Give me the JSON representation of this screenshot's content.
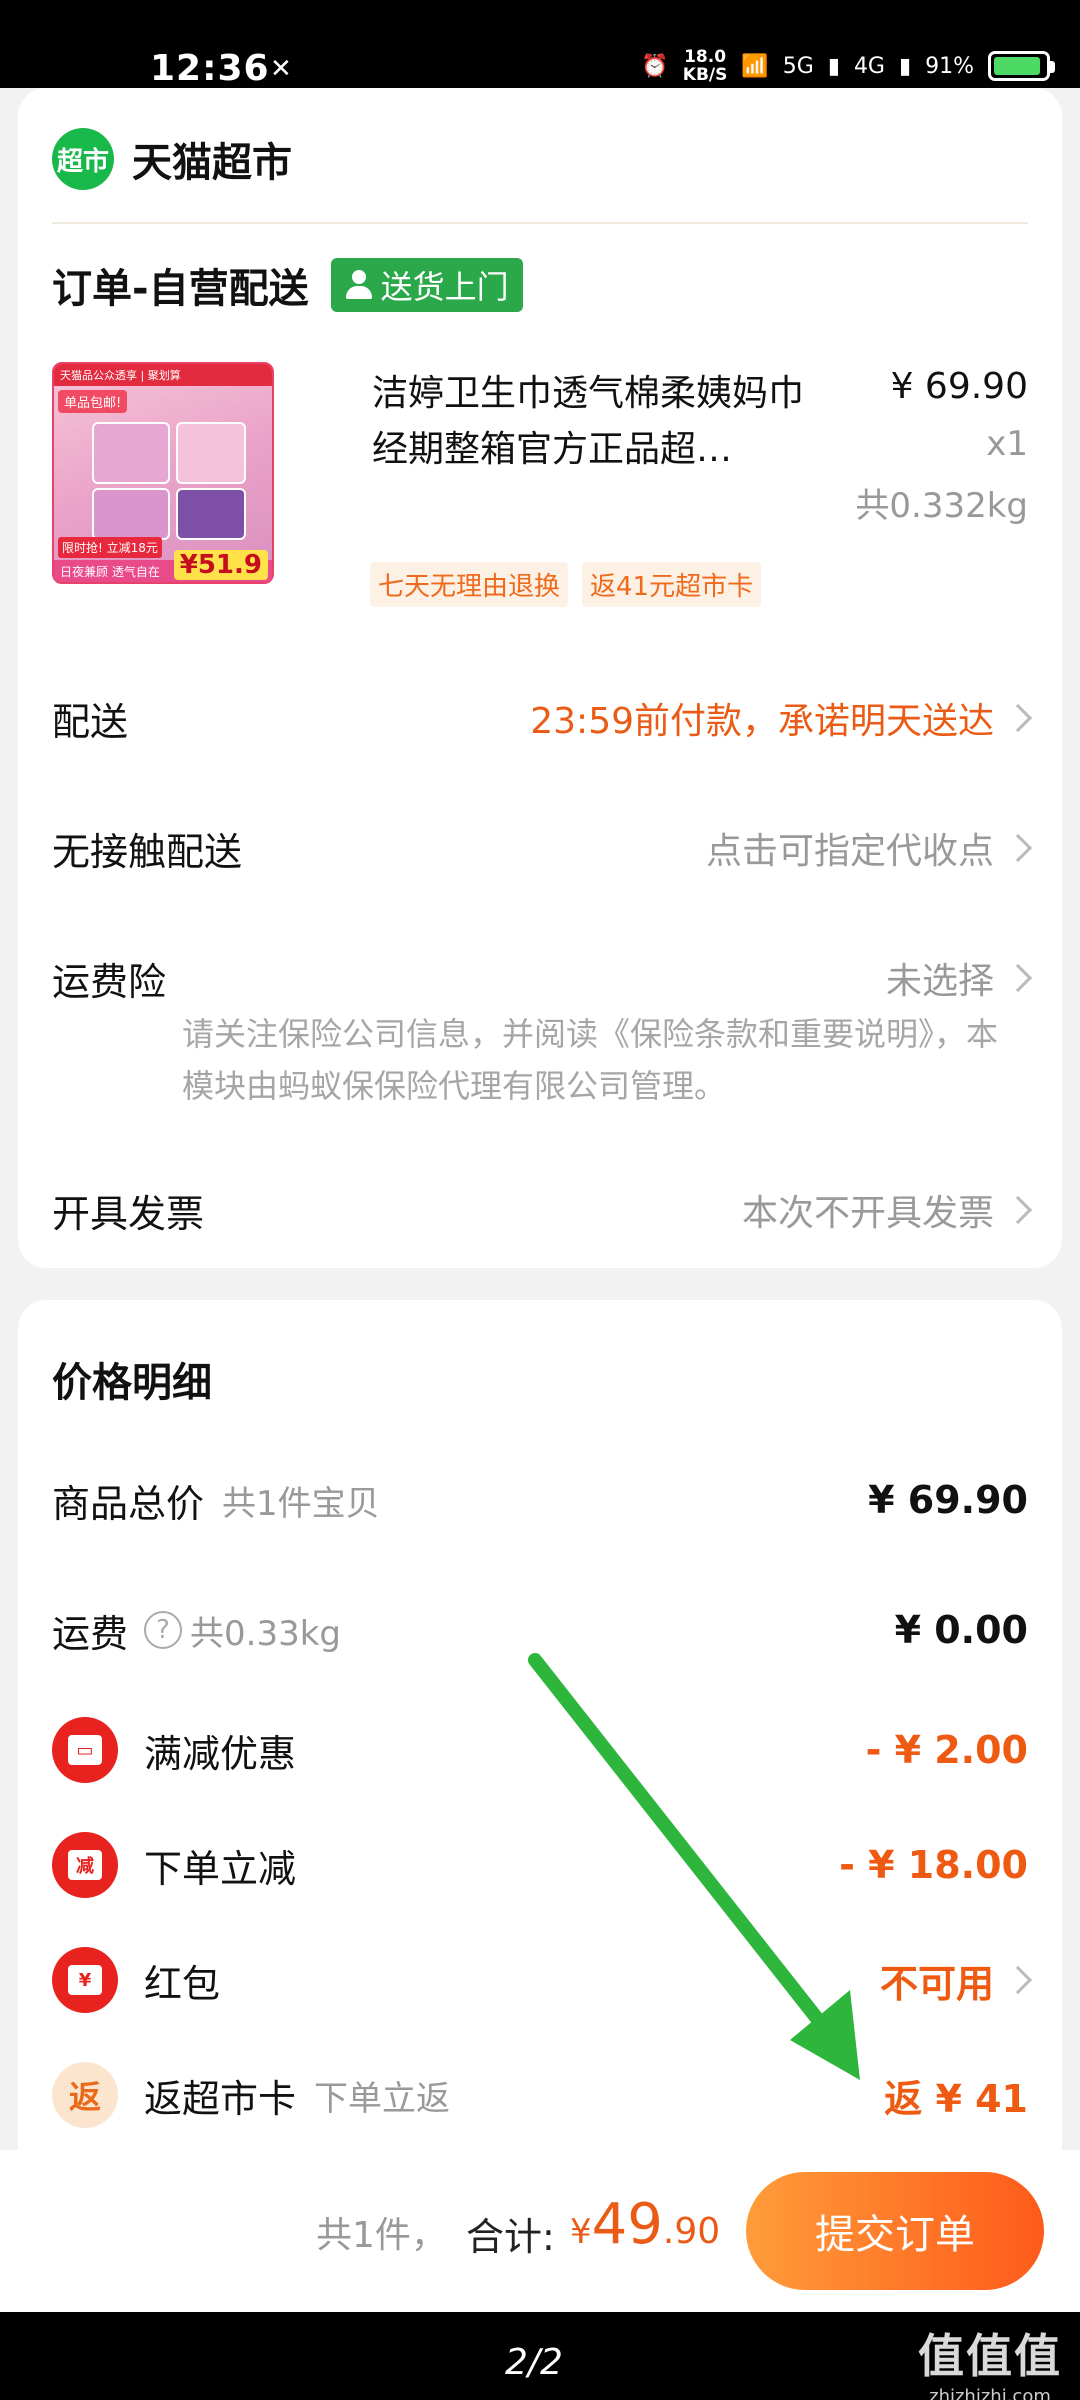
{
  "status_bar": {
    "time": "12:36",
    "net_speed": "18.0",
    "net_unit": "KB/S",
    "sig1": "5G",
    "sig2": "4G",
    "battery": "91%"
  },
  "shop": {
    "logo_text": "超市",
    "name": "天猫超市"
  },
  "order": {
    "title": "订单-自营配送",
    "delivery_tag": "送货上门"
  },
  "product": {
    "name": "洁婷卫生巾透气棉柔姨妈巾经期整箱官方正品超…",
    "price": "¥ 69.90",
    "qty": "x1",
    "weight": "共0.332kg",
    "tags": [
      "七天无理由退换",
      "返41元超市卡"
    ],
    "thumb": {
      "top_banner": "天猫品公众透享 | 聚划算",
      "badge": "单品包邮!",
      "label": "限时抢! 立减18元",
      "bottom_text": "日夜兼顾 透气自在",
      "price": "¥51.9"
    }
  },
  "rows": {
    "delivery": {
      "label": "配送",
      "value": "23:59前付款，承诺明天送达"
    },
    "contactless": {
      "label": "无接触配送",
      "value": "点击可指定代收点"
    },
    "insurance": {
      "label": "运费险",
      "value": "未选择",
      "note": "请关注保险公司信息，并阅读《保险条款和重要说明》，本模块由蚂蚁保保险代理有限公司管理。"
    },
    "invoice": {
      "label": "开具发票",
      "value": "本次不开具发票"
    }
  },
  "price_detail": {
    "title": "价格明细",
    "goods_total": {
      "label": "商品总价",
      "sub": "共1件宝贝",
      "value": "¥ 69.90"
    },
    "shipping": {
      "label": "运费",
      "sub": "共0.33kg",
      "value": "¥ 0.00"
    },
    "full_reduction": {
      "label": "满减优惠",
      "value": "- ¥ 2.00"
    },
    "instant_reduction": {
      "label": "下单立减",
      "icon_text": "减",
      "value": "- ¥ 18.00"
    },
    "red_packet": {
      "label": "红包",
      "icon_text": "¥",
      "value": "不可用"
    },
    "supermarket_card": {
      "label": "返超市卡",
      "icon_text": "返",
      "sub": "下单立返",
      "value": "返 ¥ 41"
    }
  },
  "bottom": {
    "count": "共1件，",
    "total_label": "合计:",
    "total_currency": "¥",
    "total_int": "49",
    "total_dec": ".90",
    "submit": "提交订单"
  },
  "nav": {
    "page_indicator": "2/2",
    "watermark": "值值值",
    "watermark_url": "zhizhizhi.com"
  }
}
